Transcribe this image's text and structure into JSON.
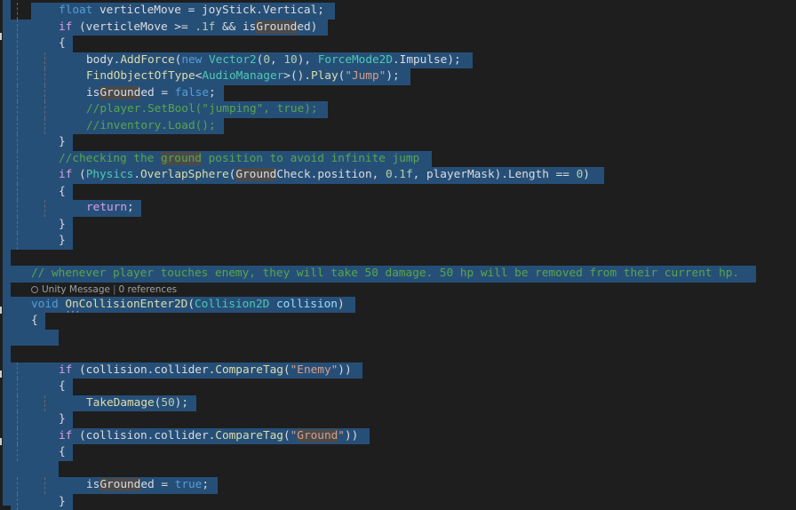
{
  "editor": {
    "language": "C#",
    "colors": {
      "background": "#1e1e1e",
      "selection": "#264f78",
      "keyword": "#569cd6",
      "control": "#d8a0df",
      "type": "#4ec9b0",
      "method": "#dcdcaa",
      "string": "#d69d85",
      "comment": "#57a64a",
      "number": "#b5cea8",
      "reference_highlight": "#4a4a4a"
    },
    "lines": [
      {
        "indent": 1,
        "tokens": [
          [
            "kw",
            "float"
          ],
          [
            "p",
            " verticleMove = joyStick.Vertical;"
          ]
        ]
      },
      {
        "indent": 1,
        "tokens": [
          [
            "ctl",
            "if"
          ],
          [
            "p",
            " (verticleMove >= "
          ],
          [
            "num",
            ".1f"
          ],
          [
            "p",
            " && is"
          ],
          [
            "hl",
            "Ground"
          ],
          [
            "p",
            "ed)"
          ]
        ]
      },
      {
        "indent": 1,
        "tokens": [
          [
            "p",
            "{"
          ]
        ]
      },
      {
        "indent": 2,
        "tokens": [
          [
            "p",
            "body."
          ],
          [
            "fn",
            "AddForce"
          ],
          [
            "p",
            "("
          ],
          [
            "kw",
            "new"
          ],
          [
            "p",
            " "
          ],
          [
            "ty",
            "Vector2"
          ],
          [
            "p",
            "("
          ],
          [
            "num",
            "0"
          ],
          [
            "p",
            ", "
          ],
          [
            "num",
            "10"
          ],
          [
            "p",
            "), "
          ],
          [
            "ty",
            "ForceMode2D"
          ],
          [
            "p",
            ".Impulse);"
          ]
        ]
      },
      {
        "indent": 2,
        "tokens": [
          [
            "fn",
            "FindObjectOfType"
          ],
          [
            "p",
            "<"
          ],
          [
            "ty",
            "AudioManager"
          ],
          [
            "p",
            ">()."
          ],
          [
            "fn",
            "Play"
          ],
          [
            "p",
            "("
          ],
          [
            "str",
            "\"Jump\""
          ],
          [
            "p",
            ");"
          ]
        ]
      },
      {
        "indent": 2,
        "tokens": [
          [
            "p",
            "is"
          ],
          [
            "hl",
            "Ground"
          ],
          [
            "p",
            "ed = "
          ],
          [
            "kw",
            "false"
          ],
          [
            "p",
            ";"
          ]
        ]
      },
      {
        "indent": 2,
        "tokens": [
          [
            "cm",
            "//player.SetBool(\"jumping\", true);"
          ]
        ]
      },
      {
        "indent": 2,
        "tokens": [
          [
            "cm",
            "//inventory.Load();"
          ]
        ]
      },
      {
        "indent": 1,
        "tokens": [
          [
            "p",
            "}"
          ]
        ]
      },
      {
        "indent": 1,
        "tokens": [
          [
            "cm",
            "//checking the "
          ],
          [
            "hlcm",
            "ground"
          ],
          [
            "cm",
            " position to avoid infinite jump"
          ]
        ]
      },
      {
        "indent": 1,
        "tokens": [
          [
            "ctl",
            "if"
          ],
          [
            "p",
            " ("
          ],
          [
            "ty",
            "Physics"
          ],
          [
            "p",
            "."
          ],
          [
            "fn",
            "OverlapSphere"
          ],
          [
            "p",
            "("
          ],
          [
            "hl",
            "Ground"
          ],
          [
            "p",
            "Check.position, "
          ],
          [
            "num",
            "0.1f"
          ],
          [
            "p",
            ", playerMask).Length == "
          ],
          [
            "num",
            "0"
          ],
          [
            "p",
            ")"
          ]
        ]
      },
      {
        "indent": 1,
        "tokens": [
          [
            "p",
            "{"
          ]
        ]
      },
      {
        "indent": 2,
        "tokens": [
          [
            "ctl",
            "return"
          ],
          [
            "p",
            ";"
          ]
        ]
      },
      {
        "indent": 1,
        "tokens": [
          [
            "p",
            "}"
          ]
        ]
      },
      {
        "indent": 1,
        "tokens": [
          [
            "p",
            "}"
          ]
        ]
      },
      {
        "indent": 0,
        "tokens": []
      },
      {
        "indent": 0,
        "tokens": [
          [
            "cm",
            "// whenever player touches enemy, they will take 50 damage. 50 hp will be removed from their current hp."
          ]
        ]
      },
      {
        "indent": 0,
        "codelens": true
      },
      {
        "indent": 0,
        "tokens": [
          [
            "kw",
            "void"
          ],
          [
            "p",
            " "
          ],
          [
            "fn",
            "OnCollisionEnter2D"
          ],
          [
            "p",
            "("
          ],
          [
            "ty",
            "Collision2D"
          ],
          [
            "p",
            " "
          ],
          [
            "var",
            "collision"
          ],
          [
            "p",
            ")"
          ]
        ]
      },
      {
        "indent": 0,
        "tokens": [
          [
            "p",
            "{"
          ]
        ]
      },
      {
        "indent": 0,
        "tokens": []
      },
      {
        "indent": 0,
        "tokens": []
      },
      {
        "indent": 1,
        "tokens": [
          [
            "ctl",
            "if"
          ],
          [
            "p",
            " (collision.collider."
          ],
          [
            "fn",
            "CompareTag"
          ],
          [
            "p",
            "("
          ],
          [
            "str",
            "\"Enemy\""
          ],
          [
            "p",
            "))"
          ]
        ]
      },
      {
        "indent": 1,
        "tokens": [
          [
            "p",
            "{"
          ]
        ]
      },
      {
        "indent": 2,
        "tokens": [
          [
            "fn",
            "TakeDamage"
          ],
          [
            "p",
            "("
          ],
          [
            "num",
            "50"
          ],
          [
            "p",
            ");"
          ]
        ]
      },
      {
        "indent": 1,
        "tokens": [
          [
            "p",
            "}"
          ]
        ]
      },
      {
        "indent": 1,
        "tokens": [
          [
            "ctl",
            "if"
          ],
          [
            "p",
            " (collision.collider."
          ],
          [
            "fn",
            "CompareTag"
          ],
          [
            "p",
            "("
          ],
          [
            "str",
            "\""
          ],
          [
            "hlstr",
            "Ground"
          ],
          [
            "str",
            "\""
          ],
          [
            "p",
            "))"
          ]
        ]
      },
      {
        "indent": 1,
        "tokens": [
          [
            "p",
            "{"
          ]
        ]
      },
      {
        "indent": 0,
        "tokens": []
      },
      {
        "indent": 2,
        "tokens": [
          [
            "p",
            "is"
          ],
          [
            "hl",
            "Ground"
          ],
          [
            "p",
            "ed = "
          ],
          [
            "kw",
            "true"
          ],
          [
            "p",
            ";"
          ]
        ]
      },
      {
        "indent": 1,
        "tokens": [
          [
            "p",
            "}"
          ]
        ]
      }
    ],
    "codelens": {
      "unity_label": "Unity Message",
      "separator": "|",
      "references_label": "0 references"
    }
  }
}
